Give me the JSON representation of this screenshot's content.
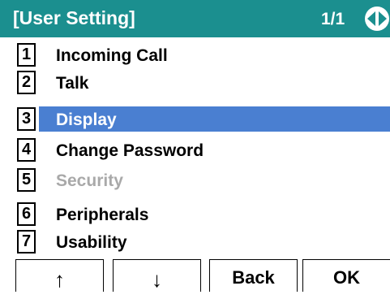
{
  "header": {
    "title": "[User Setting]",
    "page_indicator": "1/1",
    "nav_icon": "left-right-arrow-icon"
  },
  "menu": {
    "items": [
      {
        "number": "1",
        "label": "Incoming Call",
        "state": "normal"
      },
      {
        "number": "2",
        "label": "Talk",
        "state": "normal"
      },
      {
        "number": "3",
        "label": "Display",
        "state": "selected"
      },
      {
        "number": "4",
        "label": "Change Password",
        "state": "normal"
      },
      {
        "number": "5",
        "label": "Security",
        "state": "disabled"
      },
      {
        "number": "6",
        "label": "Peripherals",
        "state": "normal"
      },
      {
        "number": "7",
        "label": "Usability",
        "state": "normal"
      }
    ]
  },
  "softkeys": {
    "up_label": "↑",
    "down_label": "↓",
    "back_label": "Back",
    "ok_label": "OK"
  },
  "colors": {
    "header_bg": "#1b8f8f",
    "selected_bg": "#4a7fd1",
    "disabled_text": "#a9a9a9"
  }
}
